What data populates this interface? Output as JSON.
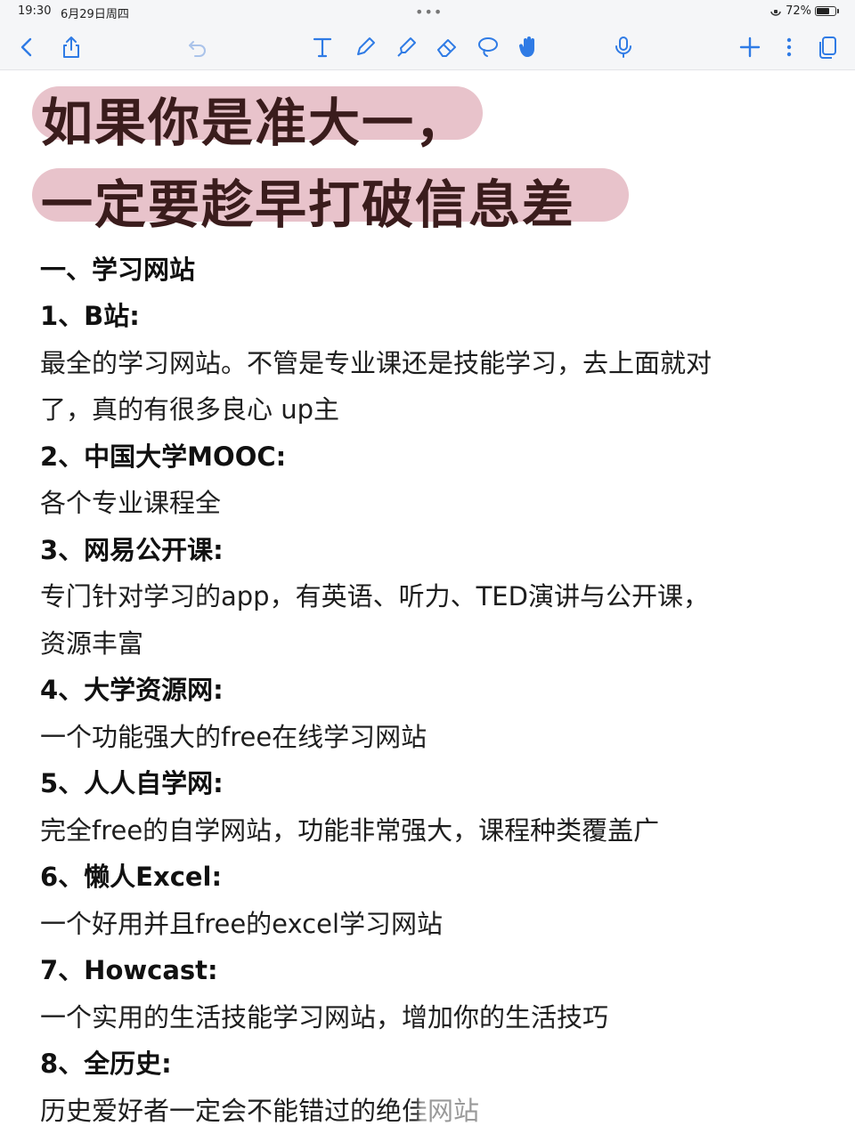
{
  "status": {
    "time": "19:30",
    "date": "6月29日周四",
    "battery": "72%",
    "battery_level": 0.72
  },
  "toolbar": {
    "icons": [
      "back-icon",
      "share-icon",
      "undo-icon",
      "text-tool-icon",
      "pen-icon",
      "highlighter-icon",
      "eraser-icon",
      "lasso-icon",
      "hand-icon",
      "mic-icon",
      "add-icon",
      "more-icon",
      "pages-icon"
    ],
    "accent": "#2f7be5"
  },
  "note": {
    "headline_1": "如果你是准大一，",
    "headline_2": "一定要趁早打破信息差",
    "highlight_color": "#e8c3cb",
    "section_title": "一、学习网站",
    "items": [
      {
        "title": "1、B站:",
        "lines": [
          "最全的学习网站。不管是专业课还是技能学习，去上面就对",
          "了，真的有很多良心 up主"
        ]
      },
      {
        "title": "2、中国大学MOOC:",
        "lines": [
          "各个专业课程全"
        ]
      },
      {
        "title": "3、网易公开课:",
        "lines": [
          "专门针对学习的app，有英语、听力、TED演讲与公开课，",
          "资源丰富"
        ]
      },
      {
        "title": "4、大学资源网:",
        "lines": [
          "一个功能强大的free在线学习网站"
        ]
      },
      {
        "title": "5、人人自学网:",
        "lines": [
          "完全free的自学网站，功能非常强大，课程种类覆盖广"
        ]
      },
      {
        "title": "6、懒人Excel:",
        "lines": [
          "一个好用并且free的excel学习网站"
        ]
      },
      {
        "title": "7、Howcast:",
        "lines": [
          "一个实用的生活技能学习网站，增加你的生活技巧"
        ]
      },
      {
        "title": "8、全历史:",
        "lines": [
          "历史爱好者一定会不能错过的绝佳网站"
        ]
      }
    ]
  }
}
